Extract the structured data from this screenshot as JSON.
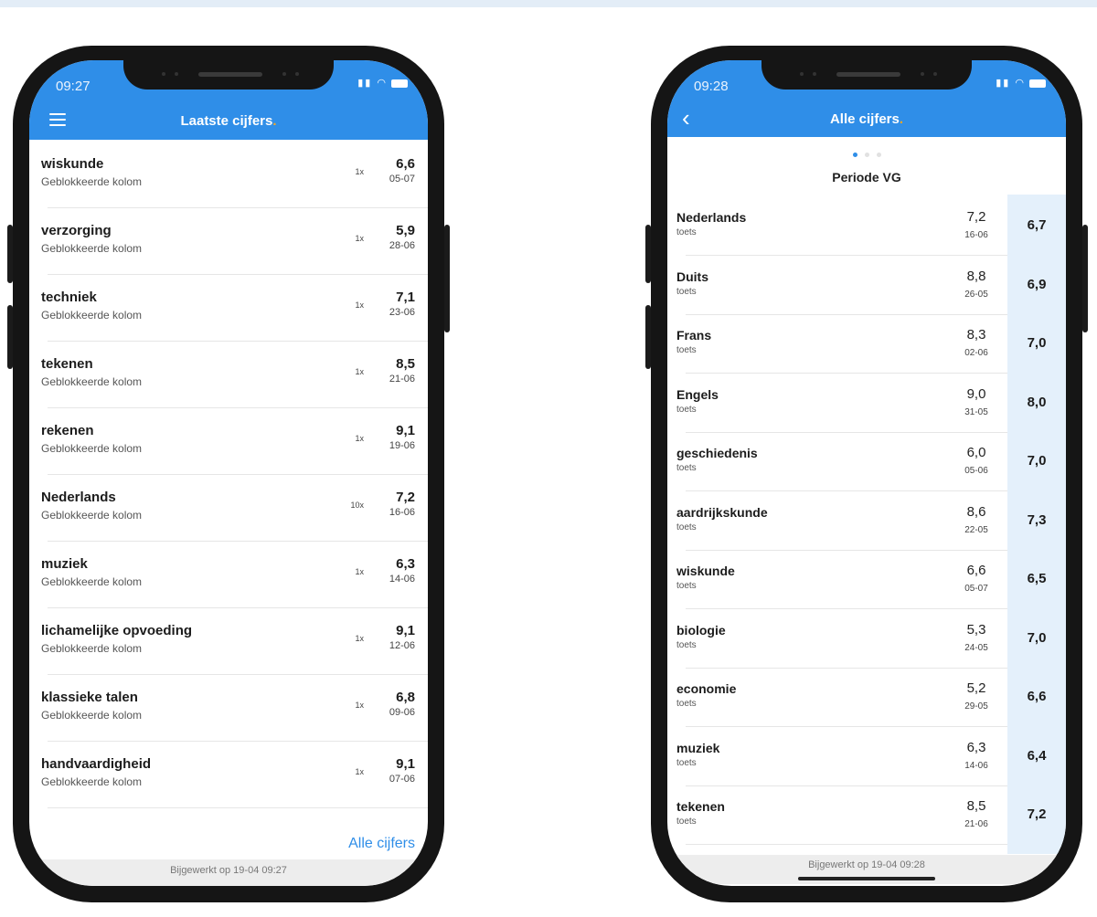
{
  "colors": {
    "accent": "#2f8ee8",
    "title_dot": "#f5a623",
    "avg_column": "#e4f0fb"
  },
  "left_phone": {
    "status_time": "09:27",
    "title": "Laatste cijfers",
    "title_dot": ".",
    "rows": [
      {
        "subject": "wiskunde",
        "sub": "Geblokkeerde kolom",
        "weight": "1x",
        "grade": "6,6",
        "date": "05-07"
      },
      {
        "subject": "verzorging",
        "sub": "Geblokkeerde kolom",
        "weight": "1x",
        "grade": "5,9",
        "date": "28-06"
      },
      {
        "subject": "techniek",
        "sub": "Geblokkeerde kolom",
        "weight": "1x",
        "grade": "7,1",
        "date": "23-06"
      },
      {
        "subject": "tekenen",
        "sub": "Geblokkeerde kolom",
        "weight": "1x",
        "grade": "8,5",
        "date": "21-06"
      },
      {
        "subject": "rekenen",
        "sub": "Geblokkeerde kolom",
        "weight": "1x",
        "grade": "9,1",
        "date": "19-06"
      },
      {
        "subject": "Nederlands",
        "sub": "Geblokkeerde kolom",
        "weight": "10x",
        "grade": "7,2",
        "date": "16-06"
      },
      {
        "subject": "muziek",
        "sub": "Geblokkeerde kolom",
        "weight": "1x",
        "grade": "6,3",
        "date": "14-06"
      },
      {
        "subject": "lichamelijke opvoeding",
        "sub": "Geblokkeerde kolom",
        "weight": "1x",
        "grade": "9,1",
        "date": "12-06"
      },
      {
        "subject": "klassieke talen",
        "sub": "Geblokkeerde kolom",
        "weight": "1x",
        "grade": "6,8",
        "date": "09-06"
      },
      {
        "subject": "handvaardigheid",
        "sub": "Geblokkeerde kolom",
        "weight": "1x",
        "grade": "9,1",
        "date": "07-06"
      }
    ],
    "all_grades_link": "Alle cijfers",
    "updated": "Bijgewerkt op 19-04 09:27"
  },
  "right_phone": {
    "status_time": "09:28",
    "title": "Alle cijfers",
    "title_dot": ".",
    "period": "Periode VG",
    "rows": [
      {
        "subject": "Nederlands",
        "sub": "toets",
        "grade": "7,2",
        "date": "16-06",
        "avg": "6,7"
      },
      {
        "subject": "Duits",
        "sub": "toets",
        "grade": "8,8",
        "date": "26-05",
        "avg": "6,9"
      },
      {
        "subject": "Frans",
        "sub": "toets",
        "grade": "8,3",
        "date": "02-06",
        "avg": "7,0"
      },
      {
        "subject": "Engels",
        "sub": "toets",
        "grade": "9,0",
        "date": "31-05",
        "avg": "8,0"
      },
      {
        "subject": "geschiedenis",
        "sub": "toets",
        "grade": "6,0",
        "date": "05-06",
        "avg": "7,0"
      },
      {
        "subject": "aardrijkskunde",
        "sub": "toets",
        "grade": "8,6",
        "date": "22-05",
        "avg": "7,3"
      },
      {
        "subject": "wiskunde",
        "sub": "toets",
        "grade": "6,6",
        "date": "05-07",
        "avg": "6,5"
      },
      {
        "subject": "biologie",
        "sub": "toets",
        "grade": "5,3",
        "date": "24-05",
        "avg": "7,0"
      },
      {
        "subject": "economie",
        "sub": "toets",
        "grade": "5,2",
        "date": "29-05",
        "avg": "6,6"
      },
      {
        "subject": "muziek",
        "sub": "toets",
        "grade": "6,3",
        "date": "14-06",
        "avg": "6,4"
      },
      {
        "subject": "tekenen",
        "sub": "toets",
        "grade": "8,5",
        "date": "21-06",
        "avg": "7,2"
      }
    ],
    "updated": "Bijgewerkt op 19-04 09:28"
  }
}
